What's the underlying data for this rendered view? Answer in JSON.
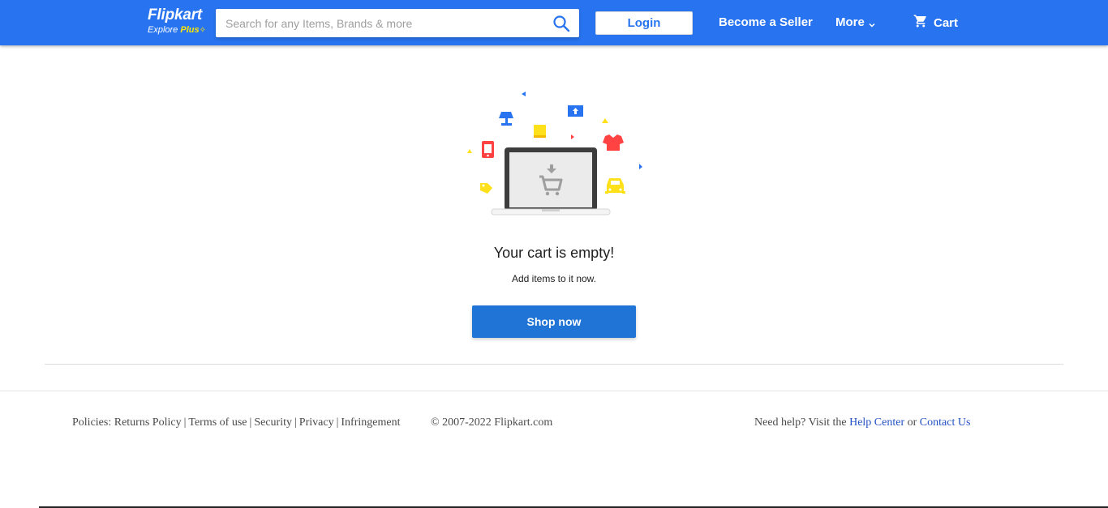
{
  "header": {
    "logo_main": "Flipkart",
    "logo_explore": "Explore",
    "logo_plus": "Plus",
    "search_placeholder": "Search for any Items, Brands & more",
    "login_label": "Login",
    "seller_label": "Become a Seller",
    "more_label": "More",
    "cart_label": "Cart",
    "bg_color": "#2874f0"
  },
  "empty_cart": {
    "title": "Your cart is empty!",
    "subtitle": "Add items to it now.",
    "button_label": "Shop now"
  },
  "footer": {
    "policies_prefix": "Policies:",
    "policies": [
      "Returns Policy",
      "Terms of use",
      "Security",
      "Privacy",
      "Infringement"
    ],
    "copyright": "© 2007-2022 Flipkart.com",
    "help_prefix": "Need help? Visit the",
    "help_center": "Help Center",
    "help_or": "or",
    "contact_us": "Contact Us"
  }
}
